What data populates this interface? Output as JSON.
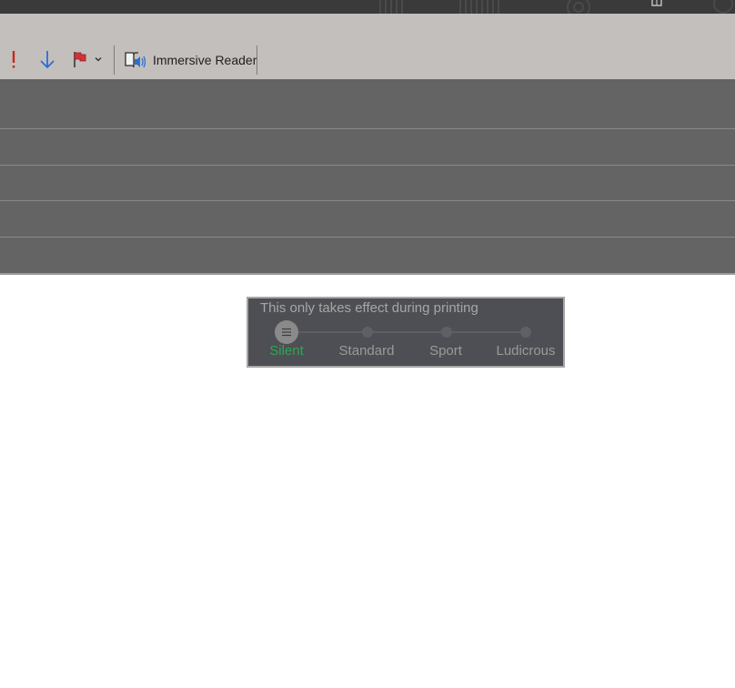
{
  "ribbon": {
    "importance_icon": "exclamation-icon",
    "low_importance_icon": "down-arrow-icon",
    "flag_icon": "flag-icon",
    "flag_dropdown_icon": "chevron-down-icon",
    "immersive_reader_icon": "immersive-reader-icon",
    "immersive_reader_label": "Immersive Reader"
  },
  "print_mode_popup": {
    "hint": "This only takes effect during printing",
    "levels": [
      "Silent",
      "Standard",
      "Sport",
      "Ludicrous"
    ],
    "selected_index": 0,
    "selected_color": "#2aa84f"
  }
}
